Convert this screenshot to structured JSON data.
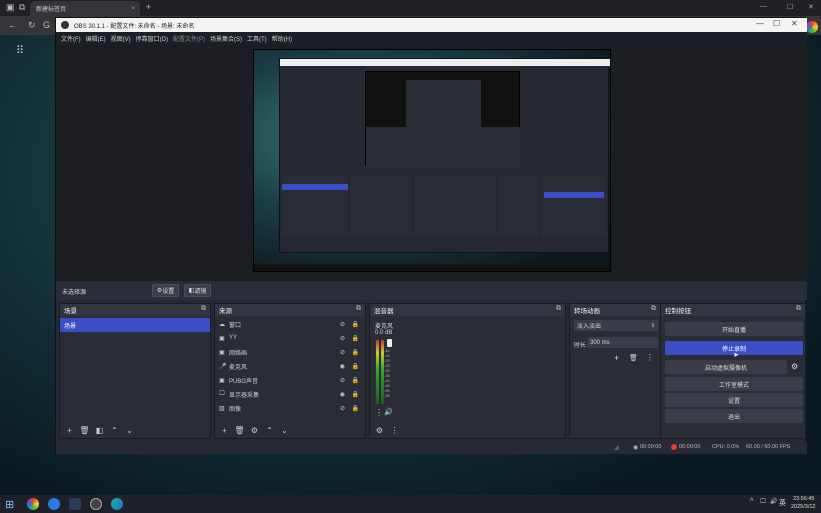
{
  "browser": {
    "tab_title": "新建标签页",
    "tab_close": "×",
    "new_tab": "+",
    "window_controls": [
      "—",
      "☐",
      "✕"
    ]
  },
  "obs": {
    "title": "OBS 30.1.1 - 配置文件: 未命名 - 场景: 未命名",
    "menu": [
      "文件(F)",
      "编辑(E)",
      "视图(V)",
      "停靠窗口(D)",
      "配置文件(P)",
      "场景集合(S)",
      "工具(T)",
      "帮助(H)"
    ],
    "source_bar": {
      "label": "未选择源",
      "properties_label": "设置",
      "filters_label": "滤镜"
    },
    "docks": {
      "scenes": {
        "title": "场景",
        "items": [
          "场景"
        ]
      },
      "sources": {
        "title": "来源",
        "items": [
          "窗口",
          "YY",
          "网络画",
          "麦克风",
          "PUBG声音",
          "显示器采集",
          "图像"
        ]
      },
      "mixer": {
        "title": "混音器",
        "channel": "麦克风",
        "db": "0.0 dB",
        "scale": [
          "0",
          "-5",
          "-10",
          "-15",
          "-20",
          "-25",
          "-30",
          "-35",
          "-40",
          "-45",
          "-50",
          "-55",
          "-60"
        ]
      },
      "transitions": {
        "title": "转场动画",
        "type": "淡入淡出",
        "duration_label": "时长",
        "duration_value": "300 ms"
      },
      "controls": {
        "title": "控制按钮",
        "start_stream": "开始直播",
        "stop_record": "停止录制",
        "virtual_cam": "启动虚拟摄像机",
        "studio_mode": "工作室模式",
        "settings": "设置",
        "exit": "退出"
      }
    },
    "status": {
      "stream_time": "00:00:00",
      "rec_time": "00:00:00",
      "cpu": "CPU: 0.0%",
      "fps": "60.00 / 60.00 FPS"
    }
  },
  "taskbar": {
    "time": "23:56:45",
    "date": "2025/3/12",
    "lang": "英",
    "tray_caret": "^"
  },
  "colors": {
    "accent": "#3a4fc7",
    "panel": "#2a2d36"
  }
}
